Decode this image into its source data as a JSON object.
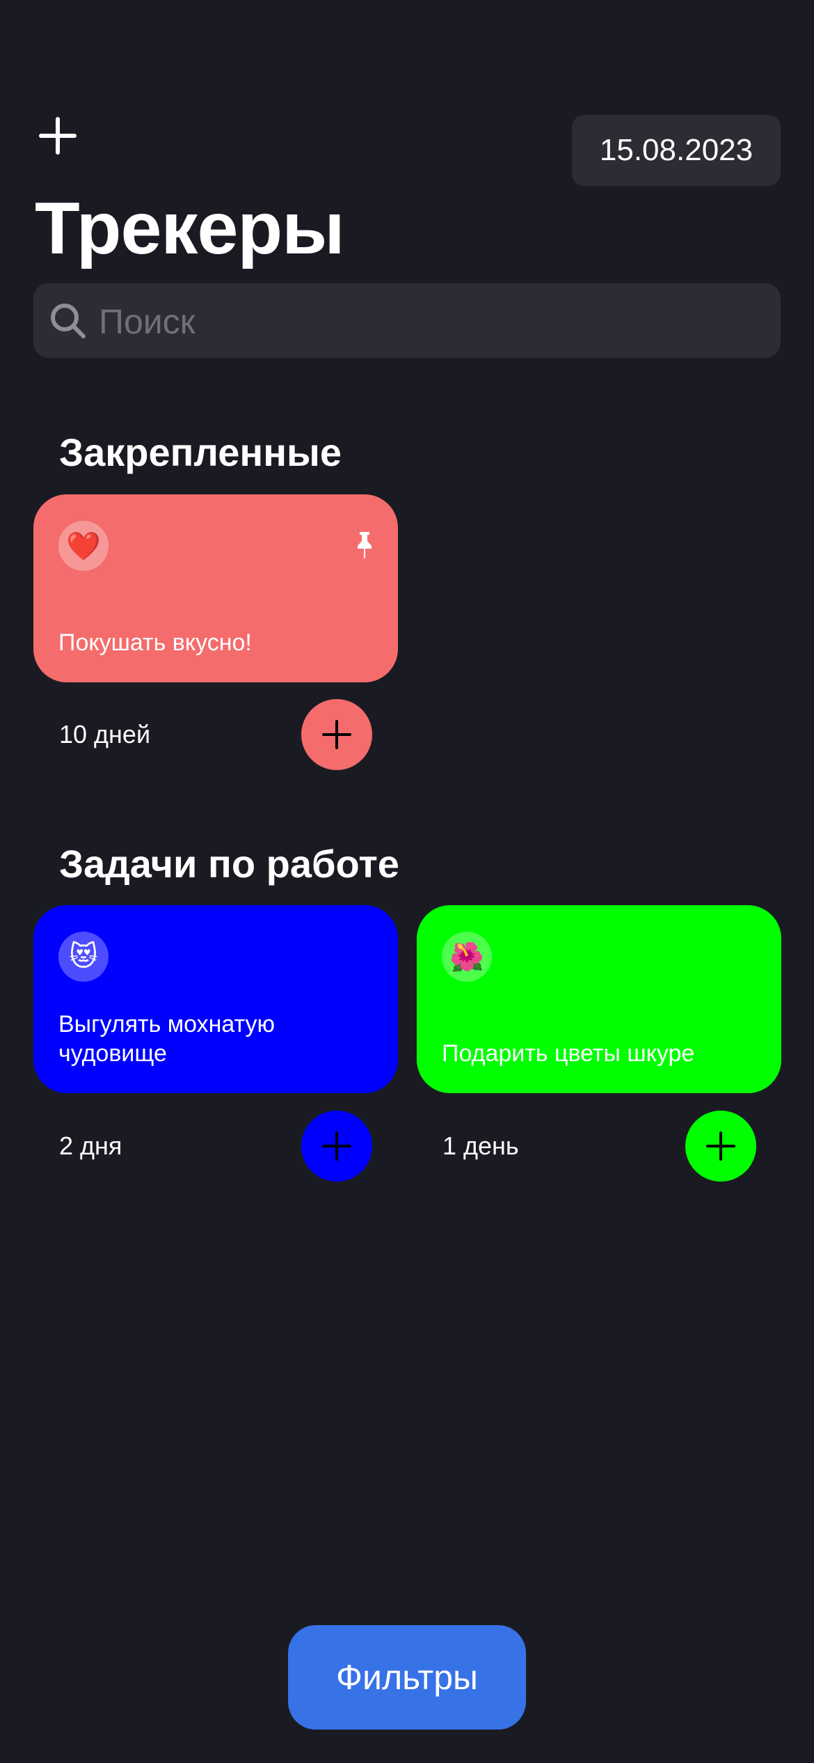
{
  "header": {
    "add_icon": "plus-icon",
    "date": "15.08.2023",
    "title": "Трекеры"
  },
  "search": {
    "placeholder": "Поиск",
    "icon": "search-icon"
  },
  "colors": {
    "background": "#1A1B22",
    "pill": "#2C2C34",
    "accent_blue": "#3772E7"
  },
  "sections": [
    {
      "title": "Закрепленные",
      "trackers": [
        {
          "emoji": "❤️",
          "title": "Покушать вкусно!",
          "days": "10 дней",
          "color": "#F46C6C",
          "pinned": true
        }
      ]
    },
    {
      "title": "Задачи по работе",
      "trackers": [
        {
          "emoji": "😻",
          "title": "Выгулять мохнатую чудовище",
          "days": "2 дня",
          "color": "#0000FF",
          "pinned": false
        },
        {
          "emoji": "🌺",
          "title": "Подарить цветы шкуре",
          "days": "1 день",
          "color": "#00FF00",
          "pinned": false
        }
      ]
    }
  ],
  "filters": {
    "label": "Фильтры"
  }
}
